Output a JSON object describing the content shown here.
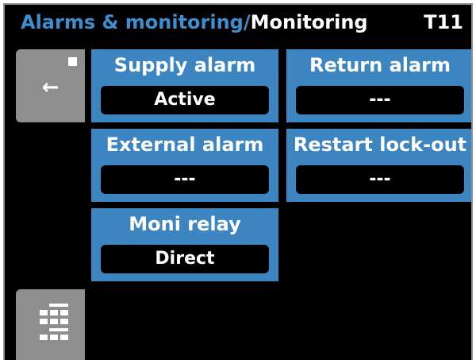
{
  "header": {
    "breadcrumb_parent": "Alarms & monitoring",
    "breadcrumb_separator": "/",
    "breadcrumb_current": "Monitoring",
    "screen_id": "T11"
  },
  "nav": {
    "back_icon": "back-arrow-icon",
    "back_glyph": "←",
    "menu_icon": "grid-menu-icon"
  },
  "tiles": [
    {
      "label": "Supply alarm",
      "value": "Active"
    },
    {
      "label": "Return alarm",
      "value": "---"
    },
    {
      "label": "External alarm",
      "value": "---"
    },
    {
      "label": "Restart lock-out",
      "value": "---"
    },
    {
      "label": "Moni relay",
      "value": "Direct"
    }
  ],
  "colors": {
    "background": "#000000",
    "accent_blue": "#3d85c1",
    "breadcrumb_blue": "#3d8fd0",
    "nav_gray": "#8e8e8e",
    "text": "#ffffff"
  }
}
